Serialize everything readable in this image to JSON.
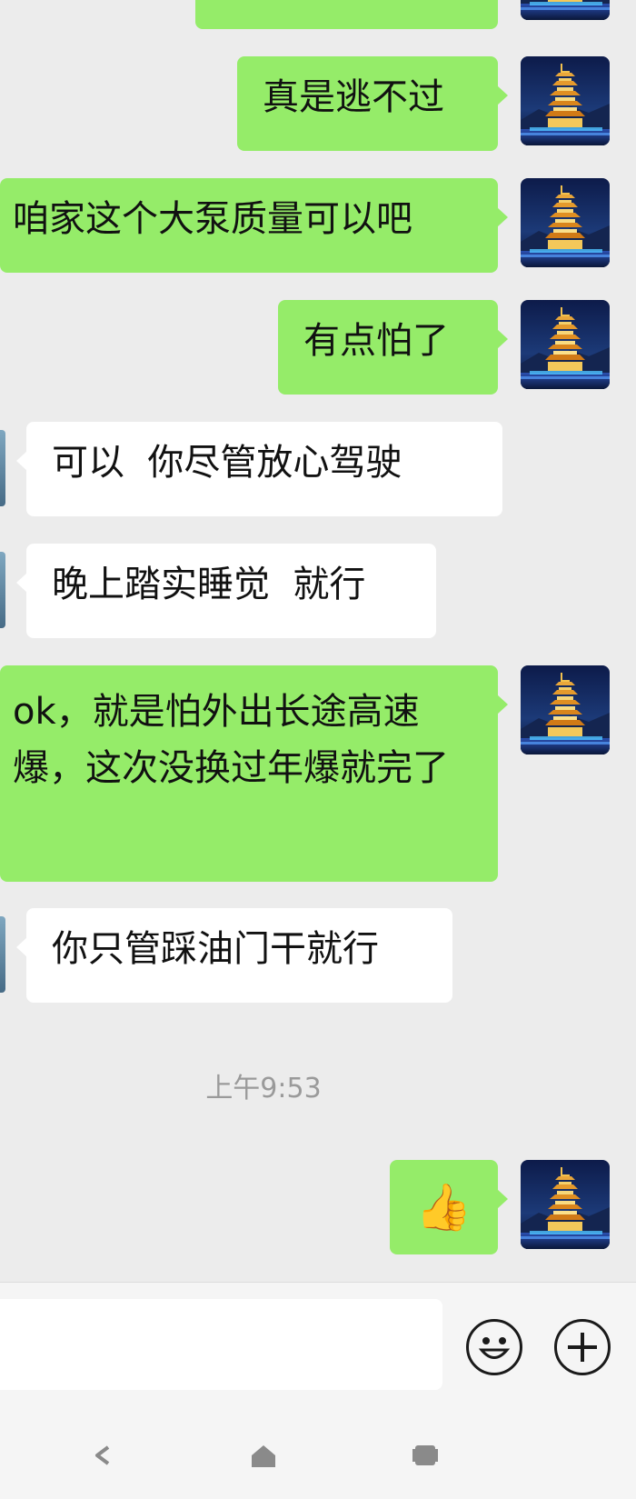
{
  "messages": [
    {
      "side": "sent",
      "text": ""
    },
    {
      "side": "sent",
      "text": "真是逃不过"
    },
    {
      "side": "sent",
      "text": "咱家这个大泵质量可以吧"
    },
    {
      "side": "sent",
      "text": "有点怕了"
    },
    {
      "side": "received",
      "text": "可以  你尽管放心驾驶"
    },
    {
      "side": "received",
      "text": "晚上踏实睡觉  就行"
    },
    {
      "side": "sent",
      "text": "ok，就是怕外出长途高速爆，这次没换过年爆就完了"
    },
    {
      "side": "received",
      "text": "你只管踩油门干就行"
    },
    {
      "side": "sent",
      "text": "👍"
    }
  ],
  "timestamp": "上午9:53",
  "avatar": {
    "description_icon": "pagoda-at-night-icon"
  },
  "colors": {
    "sent_bubble": "#95ec69",
    "received_bubble": "#ffffff",
    "background": "#ececec"
  },
  "toolbar": {
    "emoji_icon": "smiley-icon",
    "add_icon": "plus-icon"
  },
  "navbar": {
    "back_icon": "back-icon",
    "home_icon": "home-icon",
    "recents_icon": "recents-icon"
  }
}
